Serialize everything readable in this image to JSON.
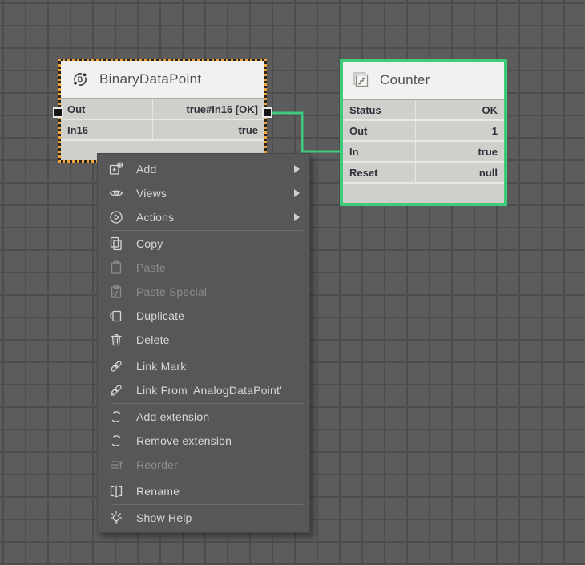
{
  "blocks": {
    "binary_data_point": {
      "title": "BinaryDataPoint",
      "rows": [
        {
          "name": "Out",
          "value": "true#In16 [OK]"
        },
        {
          "name": "In16",
          "value": "true"
        }
      ]
    },
    "counter": {
      "title": "Counter",
      "rows": [
        {
          "name": "Status",
          "value": "OK"
        },
        {
          "name": "Out",
          "value": "1"
        },
        {
          "name": "In",
          "value": "true"
        },
        {
          "name": "Reset",
          "value": "null"
        }
      ]
    }
  },
  "wire": {
    "from": "BinaryDataPoint.Out",
    "to": "Counter.In",
    "color": "#3ecc7c"
  },
  "colors": {
    "selection_orange": "#efa43c",
    "highlight_green": "#3ecc7c",
    "canvas_gray": "#5c5c5c",
    "grid_line": "#4d4d4d",
    "menu_bg": "#575757"
  },
  "context_menu": {
    "items": [
      {
        "label": "Add",
        "submenu": true,
        "disabled": false
      },
      {
        "label": "Views",
        "submenu": true,
        "disabled": false
      },
      {
        "label": "Actions",
        "submenu": true,
        "disabled": false
      },
      {
        "label": "Copy",
        "submenu": false,
        "disabled": false
      },
      {
        "label": "Paste",
        "submenu": false,
        "disabled": true
      },
      {
        "label": "Paste Special",
        "submenu": false,
        "disabled": true
      },
      {
        "label": "Duplicate",
        "submenu": false,
        "disabled": false
      },
      {
        "label": "Delete",
        "submenu": false,
        "disabled": false
      },
      {
        "label": "Link Mark",
        "submenu": false,
        "disabled": false
      },
      {
        "label": "Link From 'AnalogDataPoint'",
        "submenu": false,
        "disabled": false
      },
      {
        "label": "Add extension",
        "submenu": false,
        "disabled": false
      },
      {
        "label": "Remove extension",
        "submenu": false,
        "disabled": false
      },
      {
        "label": "Reorder",
        "submenu": false,
        "disabled": true
      },
      {
        "label": "Rename",
        "submenu": false,
        "disabled": false
      },
      {
        "label": "Show Help",
        "submenu": false,
        "disabled": false
      }
    ]
  }
}
